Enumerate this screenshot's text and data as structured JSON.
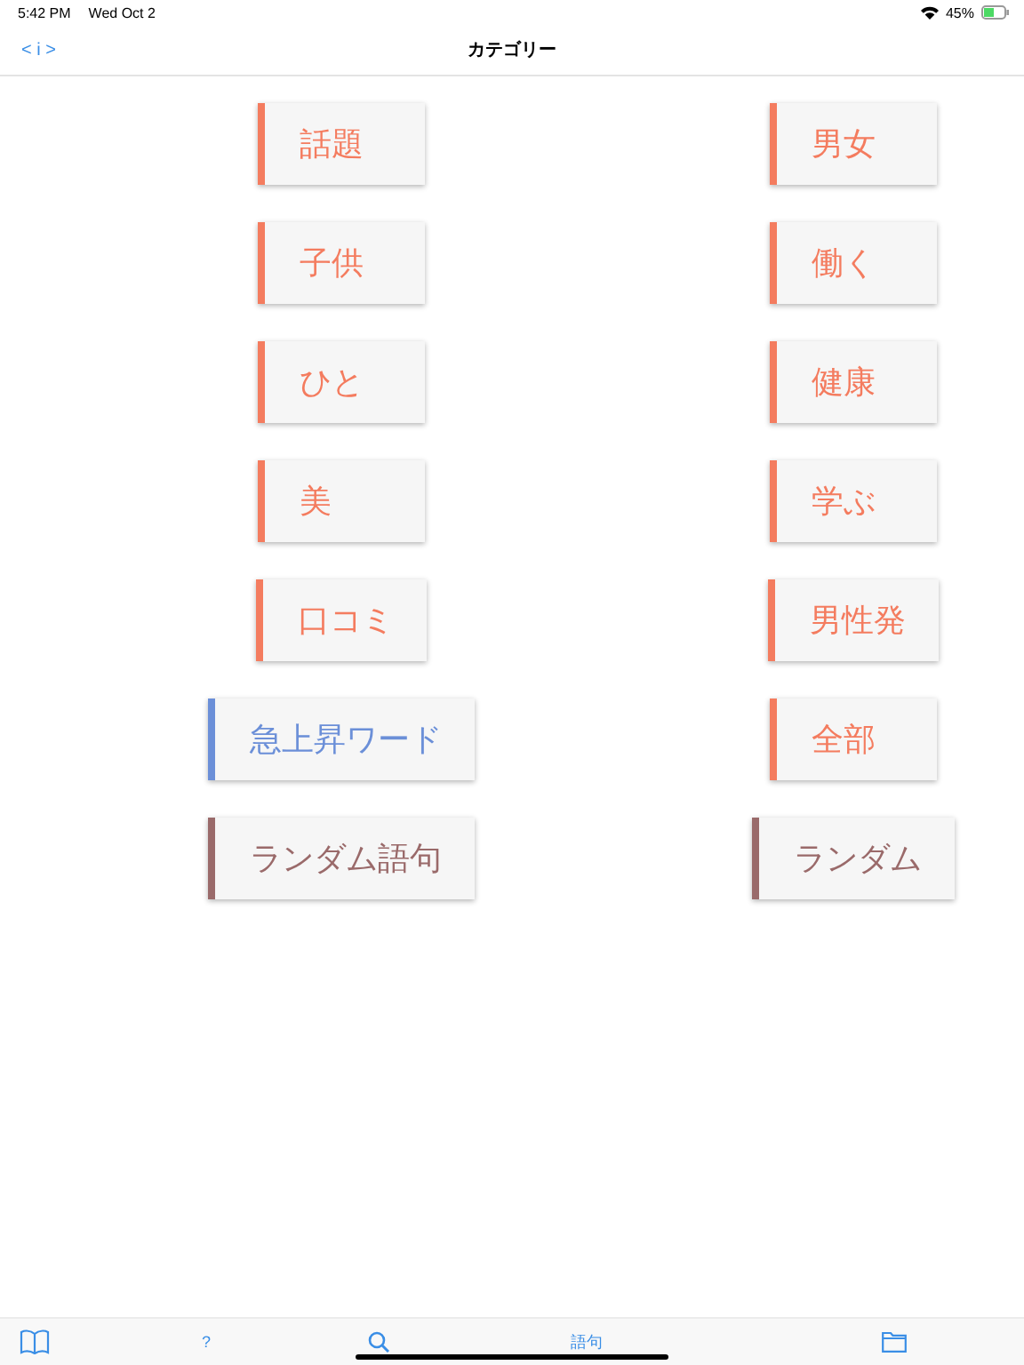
{
  "status_bar": {
    "time": "5:42 PM",
    "date": "Wed Oct 2",
    "battery": "45%"
  },
  "nav": {
    "back": "< i >",
    "title": "カテゴリー"
  },
  "categories": [
    {
      "label": "話題",
      "color": "#f47c5f"
    },
    {
      "label": "男女",
      "color": "#f47c5f"
    },
    {
      "label": "子供",
      "color": "#f47c5f"
    },
    {
      "label": "働く",
      "color": "#f47c5f"
    },
    {
      "label": "ひと",
      "color": "#f47c5f"
    },
    {
      "label": "健康",
      "color": "#f47c5f"
    },
    {
      "label": "美",
      "color": "#f47c5f"
    },
    {
      "label": "学ぶ",
      "color": "#f47c5f"
    },
    {
      "label": "口コミ",
      "color": "#f47c5f"
    },
    {
      "label": "男性発",
      "color": "#f47c5f"
    },
    {
      "label": "急上昇ワード",
      "color": "#6b8fd8"
    },
    {
      "label": "全部",
      "color": "#f47c5f"
    },
    {
      "label": "ランダム語句",
      "color": "#9a6a6a"
    },
    {
      "label": "ランダム",
      "color": "#9a6a6a"
    }
  ],
  "tab_bar": [
    {
      "kind": "book"
    },
    {
      "kind": "text",
      "label": "?"
    },
    {
      "kind": "search"
    },
    {
      "kind": "text",
      "label": "語句"
    },
    {
      "kind": "folder"
    }
  ]
}
